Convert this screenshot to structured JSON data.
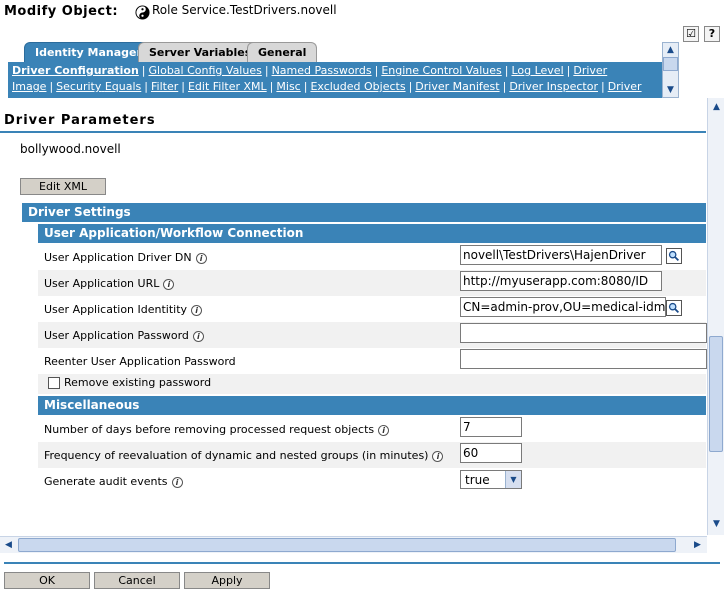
{
  "header": {
    "title": "Modify Object:",
    "object_name": "Role Service.TestDrivers.novell",
    "help_checklist_glyph": "☑",
    "help_glyph": "?"
  },
  "tabs": [
    {
      "label": "Identity Manager",
      "active": true
    },
    {
      "label": "Server Variables",
      "active": false
    },
    {
      "label": "General",
      "active": false
    }
  ],
  "subnav": {
    "links": [
      "Driver Configuration",
      "Global Config Values",
      "Named Passwords",
      "Engine Control Values",
      "Log Level",
      "Driver Image",
      "Security",
      "Equals",
      "Filter",
      "Edit Filter XML",
      "Misc",
      "Excluded Objects",
      "Driver Manifest",
      "Driver Inspector",
      "Driver Cache"
    ],
    "active": "Driver Configuration"
  },
  "page": {
    "section_title": "Driver Parameters",
    "driver_name": "bollywood.novell",
    "edit_xml_label": "Edit XML"
  },
  "driver_settings": {
    "title": "Driver Settings",
    "ua_section": {
      "title": "User Application/Workflow Connection",
      "fields": {
        "driver_dn": {
          "label": "User Application Driver DN",
          "value": "novell\\TestDrivers\\HajenDriver"
        },
        "url": {
          "label": "User Application URL",
          "value": "http://myuserapp.com:8080/ID"
        },
        "identity": {
          "label": "User Application Identitity",
          "value": "CN=admin-prov,OU=medical-idmsa"
        },
        "password": {
          "label": "User Application Password",
          "value": ""
        },
        "reenter": {
          "label": "Reenter User Application Password",
          "value": ""
        }
      },
      "remove_password_label": "Remove existing password"
    },
    "misc_section": {
      "title": "Miscellaneous",
      "days_label": "Number of days before removing processed request objects",
      "days_value": "7",
      "freq_label": "Frequency of reevaluation of dynamic and nested groups (in minutes)",
      "freq_value": "60",
      "audit_label": "Generate audit events",
      "audit_value": "true"
    }
  },
  "footer": {
    "ok": "OK",
    "cancel": "Cancel",
    "apply": "Apply"
  },
  "colors": {
    "accent": "#3a83b7"
  }
}
